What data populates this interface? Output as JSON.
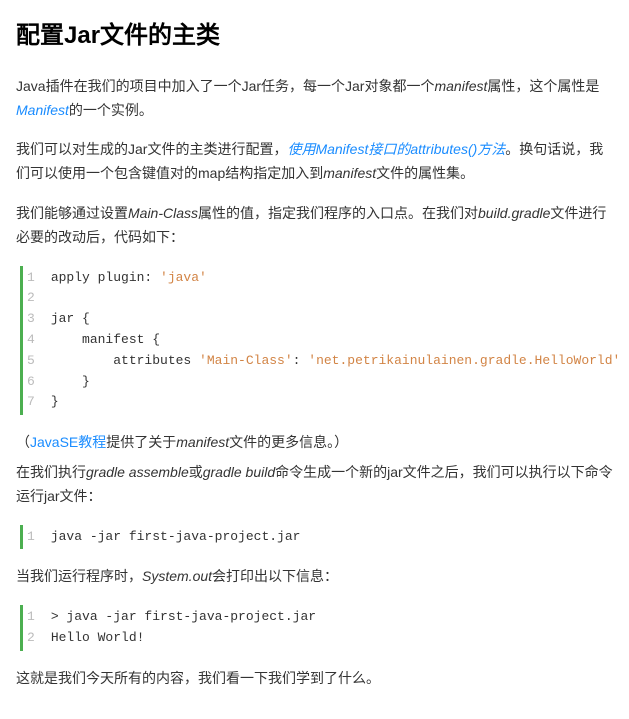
{
  "title": "配置Jar文件的主类",
  "p1_a": "Java插件在我们的项目中加入了一个Jar任务，每一个Jar对象都一个",
  "p1_i1": "manifest",
  "p1_b": "属性，这个属性是",
  "p1_link1": "Manifest",
  "p1_c": "的一个实例。",
  "p2_a": "我们可以对生成的Jar文件的主类进行配置，",
  "p2_link": "使用Manifest接口的attributes()方法",
  "p2_b": "。换句话说，我们可以使用一个包含键值对的map结构指定加入到",
  "p2_i1": "manifest",
  "p2_c": "文件的属性集。",
  "p3_a": "我们能够通过设置",
  "p3_i1": "Main-Class",
  "p3_b": "属性的值，指定我们程序的入口点。在我们对",
  "p3_i2": "build.gradle",
  "p3_c": "文件进行必要的改动后，代码如下：",
  "code1": {
    "gutter": "1\n2\n3\n4\n5\n6\n7",
    "l1a": "apply plugin: ",
    "l1s": "'java'",
    "l2": " ",
    "l3": "jar {",
    "l4": "    manifest {",
    "l5a": "        attributes ",
    "l5s1": "'Main-Class'",
    "l5b": ": ",
    "l5s2": "'net.petrikainulainen.gradle.HelloWorld'",
    "l6": "    }",
    "l7": "}"
  },
  "p4_a": "（",
  "p4_link": "JavaSE教程",
  "p4_b": "提供了关于",
  "p4_i": "manifest",
  "p4_c": "文件的更多信息。）",
  "p5_a": "在我们执行",
  "p5_i1": "gradle assemble",
  "p5_b": "或",
  "p5_i2": "gradle build",
  "p5_c": "命令生成一个新的jar文件之后，我们可以执行以下命令运行jar文件：",
  "code2": {
    "gutter": "1",
    "l1": "java -jar first-java-project.jar"
  },
  "p6_a": "当我们运行程序时，",
  "p6_i": "System.out",
  "p6_b": "会打印出以下信息：",
  "code3": {
    "gutter": "1\n2",
    "l1": "> java -jar first-java-project.jar",
    "l2": "Hello World!"
  },
  "p7": "这就是我们今天所有的内容，我们看一下我们学到了什么。"
}
